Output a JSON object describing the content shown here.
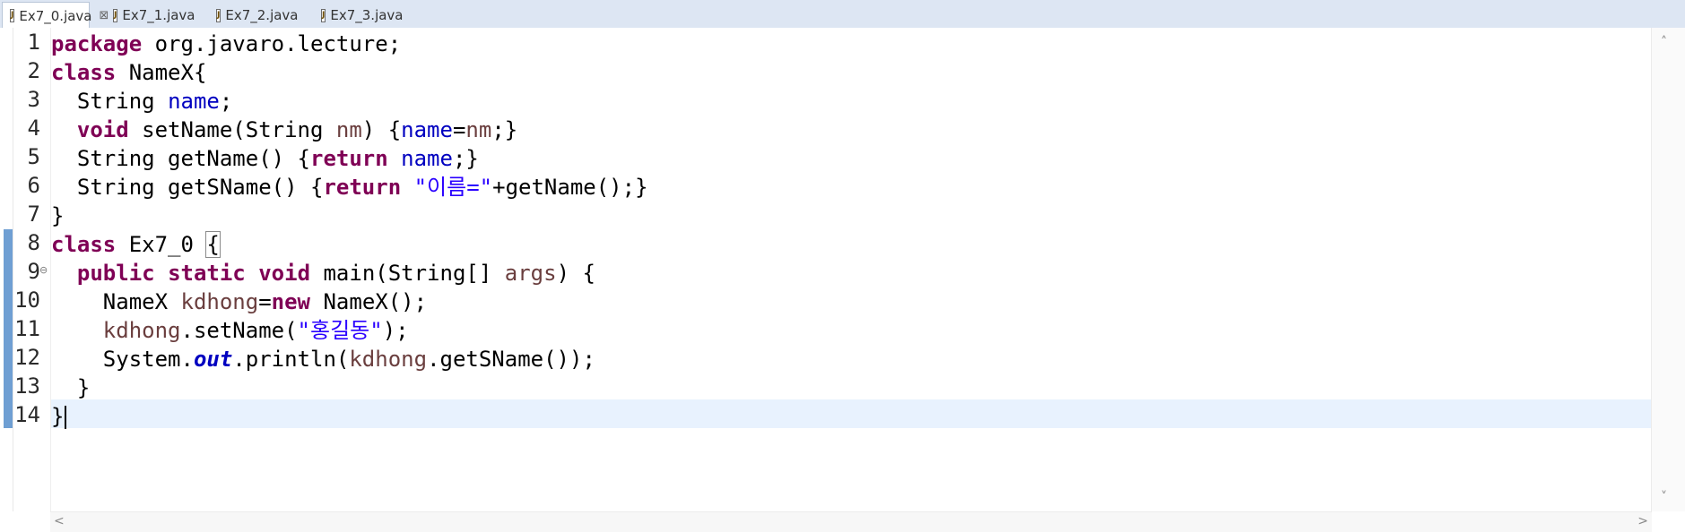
{
  "tabs": [
    {
      "label": "Ex7_0.java",
      "active": true,
      "icon": "java-file-icon",
      "close": "⊠"
    },
    {
      "label": "Ex7_1.java",
      "active": false,
      "icon": "java-file-icon"
    },
    {
      "label": "Ex7_2.java",
      "active": false,
      "icon": "java-file-icon"
    },
    {
      "label": "Ex7_3.java",
      "active": false,
      "icon": "java-file-icon"
    }
  ],
  "editor": {
    "line_numbers": [
      "1",
      "2",
      "3",
      "4",
      "5",
      "6",
      "7",
      "8",
      "9",
      "10",
      "11",
      "12",
      "13",
      "14"
    ],
    "fold_marker": "⊖",
    "current_line": 14,
    "code": {
      "l1": {
        "kw": "package",
        "rest": " org.javaro.lecture;"
      },
      "l2": {
        "kw": "class",
        "rest": " NameX{"
      },
      "l3": {
        "indent": "  ",
        "t1": "String ",
        "fld": "name",
        "t2": ";"
      },
      "l4": {
        "indent": "  ",
        "kw": "void",
        "t1": " setName(String ",
        "var": "nm",
        "t2": ") {",
        "fld": "name",
        "t3": "=",
        "var2": "nm",
        "t4": ";}"
      },
      "l5": {
        "indent": "  ",
        "t1": "String getName() {",
        "kw": "return",
        "t2": " ",
        "fld": "name",
        "t3": ";}"
      },
      "l6": {
        "indent": "  ",
        "t1": "String getSName() {",
        "kw": "return",
        "t2": " ",
        "str": "\"이름=\"",
        "t3": "+getName();}"
      },
      "l7": {
        "t1": "}"
      },
      "l8": {
        "kw": "class",
        "t1": " Ex7_0 ",
        "br": "{"
      },
      "l9": {
        "indent": "  ",
        "kw1": "public",
        "sp1": " ",
        "kw2": "static",
        "sp2": " ",
        "kw3": "void",
        "t1": " main(String[] ",
        "var": "args",
        "t2": ") {"
      },
      "l10": {
        "indent": "    ",
        "t1": "NameX ",
        "var": "kdhong",
        "t2": "=",
        "kw": "new",
        "t3": " NameX();"
      },
      "l11": {
        "indent": "    ",
        "var": "kdhong",
        "t1": ".setName(",
        "str": "\"홍길동\"",
        "t2": ");"
      },
      "l12": {
        "indent": "    ",
        "t1": "System.",
        "sfld": "out",
        "t2": ".println(",
        "var": "kdhong",
        "t3": ".getSName());"
      },
      "l13": {
        "indent": "  ",
        "t1": "}"
      },
      "l14": {
        "t1": "}"
      }
    }
  },
  "scrollbars": {
    "up": "˄",
    "down": "˅",
    "left": "<",
    "right": ">"
  }
}
